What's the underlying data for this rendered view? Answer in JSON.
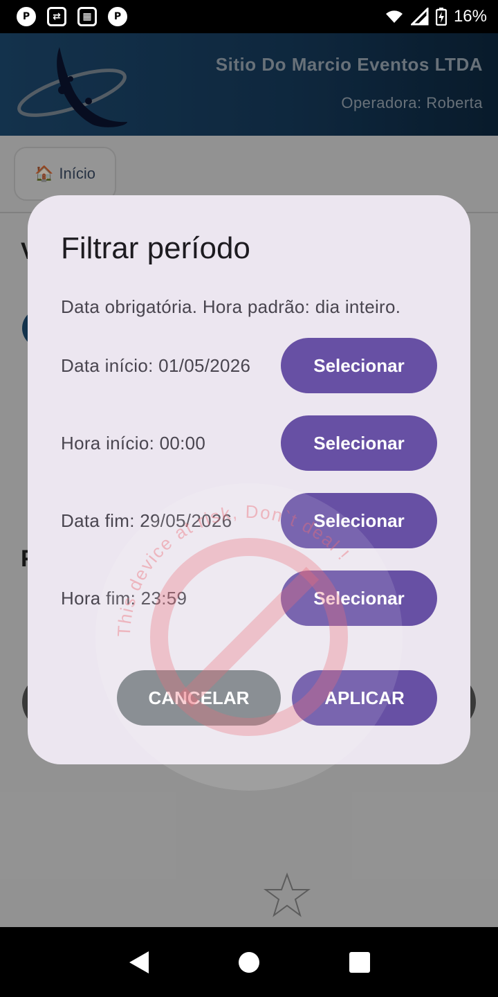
{
  "status_bar": {
    "battery": "16%",
    "left_icons": [
      "app-icon-1",
      "app-icon-2",
      "app-icon-3",
      "app-icon-4"
    ]
  },
  "header": {
    "company": "Sitio Do Marcio Eventos LTDA",
    "operator": "Operadora: Roberta"
  },
  "home_button": {
    "emoji": "🏠",
    "label": "Início"
  },
  "dialog": {
    "title": "Filtrar período",
    "subtitle": "Data obrigatória. Hora padrão: dia inteiro.",
    "rows": [
      {
        "label": "Data início: 01/05/2026",
        "button": "Selecionar"
      },
      {
        "label": "Hora início: 00:00",
        "button": "Selecionar"
      },
      {
        "label": "Data fim: 29/05/2026",
        "button": "Selecionar"
      },
      {
        "label": "Hora fim: 23:59",
        "button": "Selecionar"
      }
    ],
    "cancel": "CANCELAR",
    "apply": "APLICAR"
  },
  "watermark": {
    "text": "This device at risk, Don`t deal !"
  },
  "colors": {
    "primary": "#6750a4",
    "dialog_bg": "#ece6f0",
    "header_dark": "#163a5b",
    "cancel_bg": "#7a8086"
  }
}
